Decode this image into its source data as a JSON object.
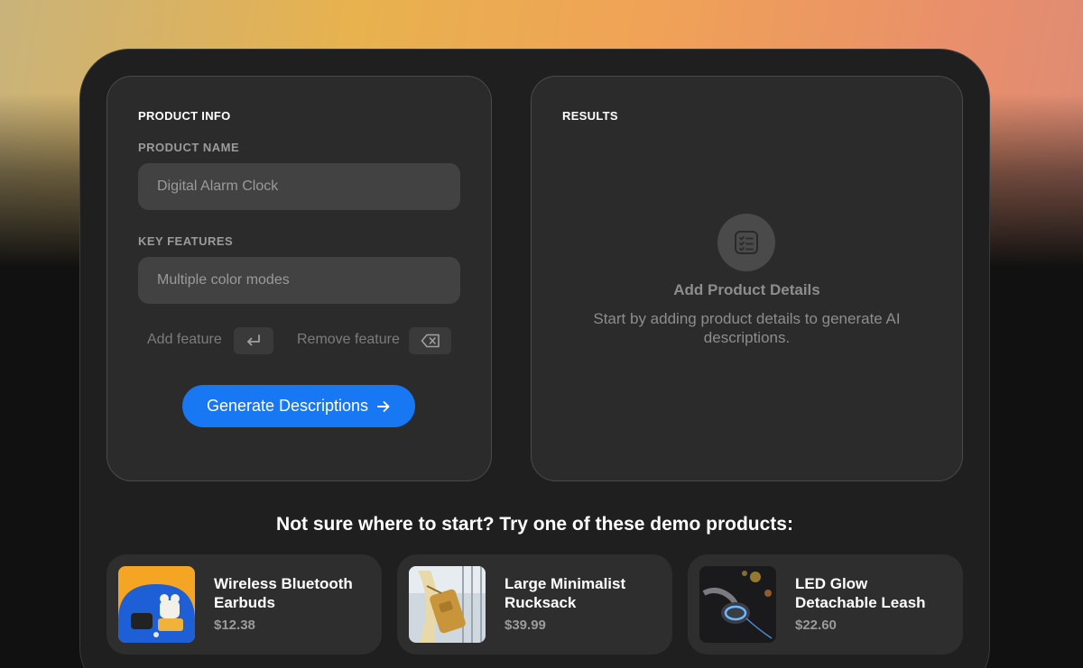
{
  "product_info": {
    "title": "PRODUCT INFO",
    "name_label": "PRODUCT NAME",
    "name_placeholder": "Digital Alarm Clock",
    "features_label": "KEY FEATURES",
    "features_placeholder": "Multiple color modes",
    "add_feature_label": "Add feature",
    "add_feature_icon": "enter-icon",
    "remove_feature_label": "Remove feature",
    "remove_feature_icon": "backspace-icon",
    "generate_label": "Generate Descriptions",
    "generate_icon": "arrow-right-icon",
    "accent_color": "#1877f2"
  },
  "results": {
    "title": "RESULTS",
    "empty_icon": "checklist-icon",
    "empty_title": "Add Product Details",
    "empty_description": "Start by adding product details to generate AI descriptions."
  },
  "demo": {
    "heading": "Not sure where to start? Try one of these demo products:",
    "products": [
      {
        "name": "Wireless Bluetooth Earbuds",
        "price": "$12.38",
        "thumb": "earbuds-photo"
      },
      {
        "name": "Large Minimalist Rucksack",
        "price": "$39.99",
        "thumb": "rucksack-photo"
      },
      {
        "name": "LED Glow Detachable Leash",
        "price": "$22.60",
        "thumb": "leash-photo"
      }
    ]
  }
}
